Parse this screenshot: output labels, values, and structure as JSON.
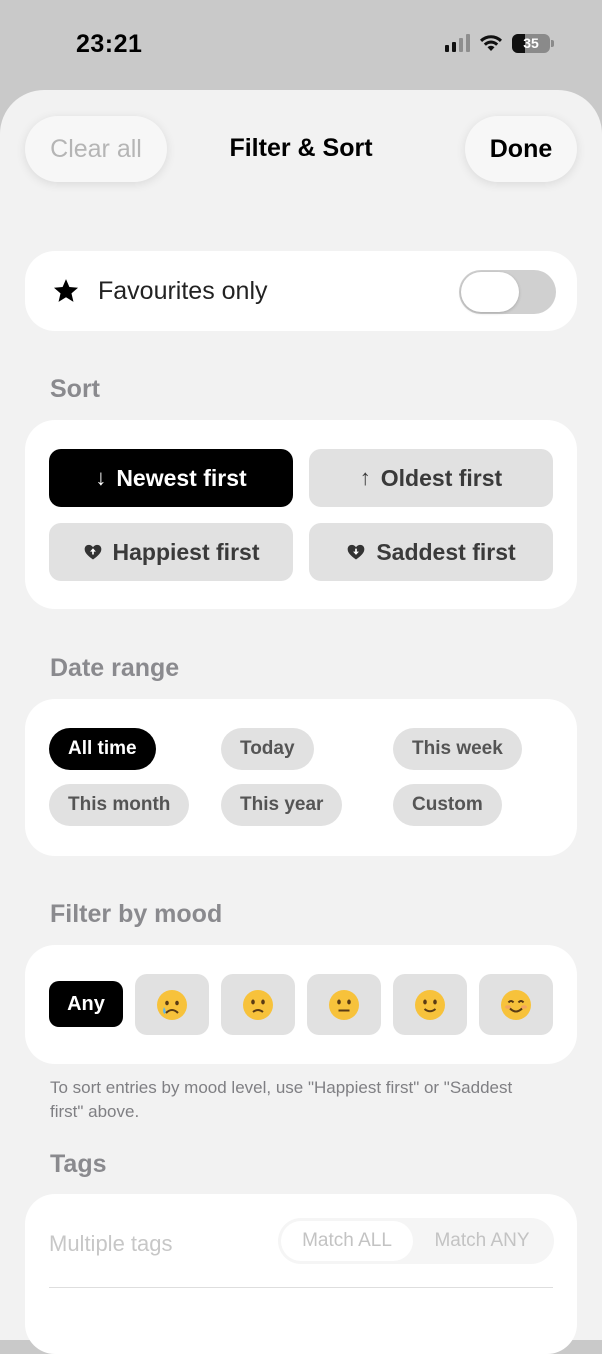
{
  "status_bar": {
    "time": "23:21",
    "battery": "35",
    "icons": [
      "signal-icon",
      "wifi-icon",
      "battery-icon"
    ]
  },
  "header": {
    "clear_label": "Clear all",
    "title": "Filter & Sort",
    "done_label": "Done"
  },
  "favourites": {
    "label": "Favourites only",
    "icon": "star-icon",
    "toggle_on": false
  },
  "sort": {
    "section_label": "Sort",
    "options": [
      {
        "label": "Newest first",
        "icon": "arrow-down-icon",
        "selected": true
      },
      {
        "label": "Oldest first",
        "icon": "arrow-up-icon",
        "selected": false
      },
      {
        "label": "Happiest first",
        "icon": "heart-up-icon",
        "selected": false
      },
      {
        "label": "Saddest first",
        "icon": "heart-down-icon",
        "selected": false
      }
    ]
  },
  "date_range": {
    "section_label": "Date range",
    "options": [
      {
        "label": "All time",
        "selected": true
      },
      {
        "label": "Today",
        "selected": false
      },
      {
        "label": "This week",
        "selected": false
      },
      {
        "label": "This month",
        "selected": false
      },
      {
        "label": "This year",
        "selected": false
      },
      {
        "label": "Custom",
        "selected": false
      }
    ]
  },
  "mood": {
    "section_label": "Filter by mood",
    "any_label": "Any",
    "options": [
      "crying-face-icon",
      "slightly-frowning-face-icon",
      "neutral-face-icon",
      "slightly-smiling-face-icon",
      "smiling-face-icon"
    ],
    "helper_text": "To sort entries by mood level, use \"Happiest first\" or \"Saddest first\" above."
  },
  "tags": {
    "section_label": "Tags",
    "placeholder": "Multiple tags",
    "match_all": "Match ALL",
    "match_any": "Match ANY"
  },
  "colors": {
    "selected": "#000000",
    "unselected": "#e1e1e1",
    "background": "#f2f2f2",
    "card": "#ffffff",
    "section_label": "#8a8a8e"
  }
}
